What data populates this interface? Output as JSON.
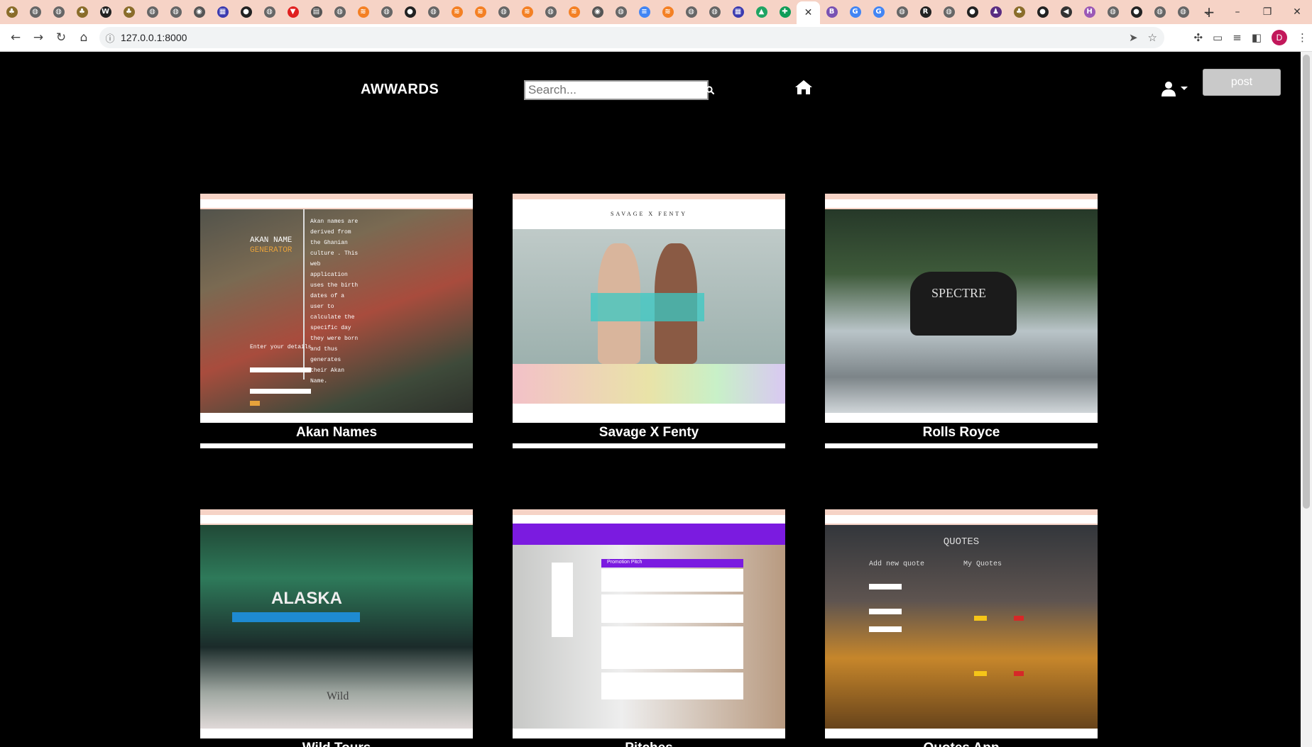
{
  "browser": {
    "url": "127.0.0.1:8000",
    "tabs": [
      {
        "icon": "tree-icon",
        "color": "#8a6d2b"
      },
      {
        "icon": "globe-icon",
        "color": "#666666"
      },
      {
        "icon": "globe-icon",
        "color": "#666666"
      },
      {
        "icon": "tree-icon",
        "color": "#8a6d2b"
      },
      {
        "icon": "w-icon",
        "color": "#222222"
      },
      {
        "icon": "tree-icon",
        "color": "#8a6d2b"
      },
      {
        "icon": "globe-icon",
        "color": "#666666"
      },
      {
        "icon": "globe-icon",
        "color": "#666666"
      },
      {
        "icon": "chrome-icon",
        "color": "#555555"
      },
      {
        "icon": "ndb-icon",
        "color": "#3b3bb0"
      },
      {
        "icon": "github-icon",
        "color": "#222222"
      },
      {
        "icon": "globe-icon",
        "color": "#666666"
      },
      {
        "icon": "vivaldi-icon",
        "color": "#e02020"
      },
      {
        "icon": "book-icon",
        "color": "#555555"
      },
      {
        "icon": "globe-icon",
        "color": "#666666"
      },
      {
        "icon": "stack-icon",
        "color": "#f48024"
      },
      {
        "icon": "globe-icon",
        "color": "#666666"
      },
      {
        "icon": "github-icon",
        "color": "#222222"
      },
      {
        "icon": "globe-icon",
        "color": "#666666"
      },
      {
        "icon": "stack-icon",
        "color": "#f48024"
      },
      {
        "icon": "stack-icon",
        "color": "#f48024"
      },
      {
        "icon": "globe-icon",
        "color": "#666666"
      },
      {
        "icon": "stack-icon",
        "color": "#f48024"
      },
      {
        "icon": "globe-icon",
        "color": "#666666"
      },
      {
        "icon": "stack-icon",
        "color": "#f48024"
      },
      {
        "icon": "chrome-icon",
        "color": "#555555"
      },
      {
        "icon": "globe-icon",
        "color": "#666666"
      },
      {
        "icon": "docs-icon",
        "color": "#4285f4"
      },
      {
        "icon": "stack-icon",
        "color": "#f48024"
      },
      {
        "icon": "globe-icon",
        "color": "#666666"
      },
      {
        "icon": "globe-icon",
        "color": "#666666"
      },
      {
        "icon": "ndb-icon",
        "color": "#3b3bb0"
      },
      {
        "icon": "drive-icon",
        "color": "#1fa463"
      },
      {
        "icon": "sheets-icon",
        "color": "#0f9d58"
      },
      {
        "icon": "close-icon",
        "color": "#333333",
        "active": true
      },
      {
        "icon": "bootstrap-icon",
        "color": "#7952b3"
      },
      {
        "icon": "google-icon",
        "color": "#4285f4"
      },
      {
        "icon": "google-icon",
        "color": "#4285f4"
      },
      {
        "icon": "globe-icon",
        "color": "#666666"
      },
      {
        "icon": "rr-icon",
        "color": "#222222"
      },
      {
        "icon": "globe-icon",
        "color": "#666666"
      },
      {
        "icon": "github-icon",
        "color": "#222222"
      },
      {
        "icon": "hat-icon",
        "color": "#5a2d82"
      },
      {
        "icon": "tree-icon",
        "color": "#8a6d2b"
      },
      {
        "icon": "github-icon",
        "color": "#222222"
      },
      {
        "icon": "sound-icon",
        "color": "#333333"
      },
      {
        "icon": "h-icon",
        "color": "#9b59b6"
      },
      {
        "icon": "globe-icon",
        "color": "#666666"
      },
      {
        "icon": "github-icon",
        "color": "#222222"
      },
      {
        "icon": "globe-icon",
        "color": "#666666"
      },
      {
        "icon": "globe-icon",
        "color": "#666666"
      }
    ],
    "profile_initial": "D"
  },
  "nav": {
    "brand": "AWWARDS",
    "search_placeholder": "Search...",
    "post_label": "post"
  },
  "projects": [
    {
      "title": "Akan Names",
      "theme": "akan"
    },
    {
      "title": "Savage X Fenty",
      "theme": "fenty"
    },
    {
      "title": "Rolls Royce",
      "theme": "rolls"
    },
    {
      "title": "Wild Tours",
      "theme": "alaska"
    },
    {
      "title": "Pitches",
      "theme": "pitch"
    },
    {
      "title": "Quotes App",
      "theme": "quotes"
    }
  ],
  "screenshot_text": {
    "akan_heading": "AKAN NAME",
    "akan_heading2": "GENERATOR",
    "akan_body": "Akan names are derived from the Ghanian culture . This web application uses the birth dates of a user to calculate the specific day they were born and thus generates their Akan Name.",
    "akan_form": "Enter your details",
    "fenty_brand": "SAVAGE X FENTY",
    "rolls_text": "SPECTRE",
    "alaska_text": "ALASKA",
    "alaska_wild": "Wild",
    "pitch_title": "Promotion Pitch",
    "quotes_title": "QUOTES",
    "quotes_add": "Add new quote",
    "quotes_mine": "My Quotes"
  }
}
